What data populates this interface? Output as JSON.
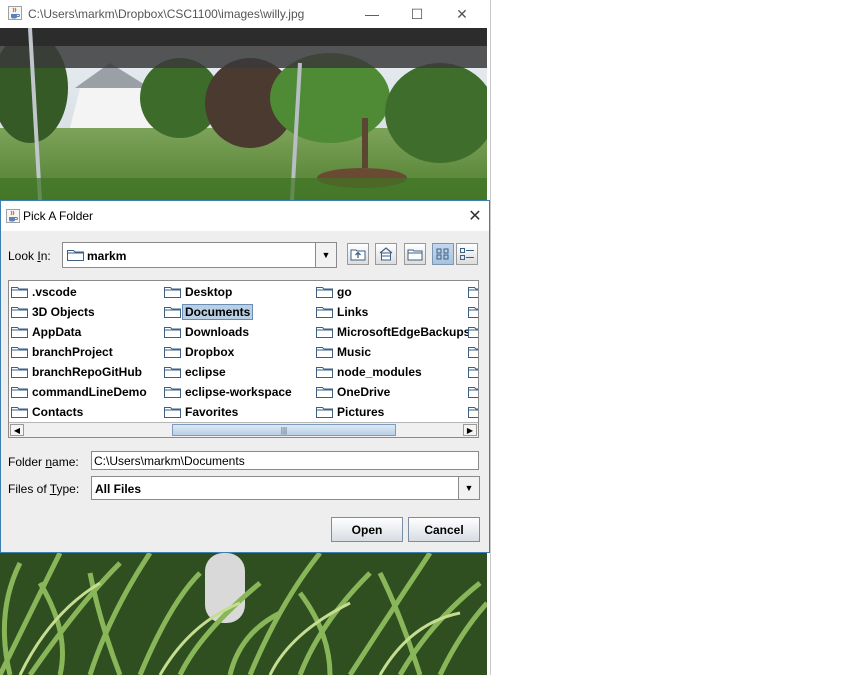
{
  "image_window": {
    "title": "C:\\Users\\markm\\Dropbox\\CSC1100\\images\\willy.jpg",
    "controls": {
      "minimize": "—",
      "maximize": "☐",
      "close": "✕"
    }
  },
  "dialog": {
    "title": "Pick A Folder",
    "close_glyph": "✕",
    "look_in": {
      "label_pre": "Look ",
      "label_mnemonic": "I",
      "label_post": "n:",
      "value": "markm"
    },
    "toolbar_icons": [
      "up-one-level-icon",
      "home-icon",
      "new-folder-icon",
      "list-view-icon",
      "details-view-icon"
    ],
    "files": {
      "columns": [
        [
          ".vscode",
          "3D Objects",
          "AppData",
          "branchProject",
          "branchRepoGitHub",
          "commandLineDemo",
          "Contacts"
        ],
        [
          "Desktop",
          "Documents",
          "Downloads",
          "Dropbox",
          "eclipse",
          "eclipse-workspace",
          "Favorites"
        ],
        [
          "go",
          "Links",
          "MicrosoftEdgeBackups",
          "Music",
          "node_modules",
          "OneDrive",
          "Pictures"
        ]
      ],
      "selected": "Documents"
    },
    "scrollbar": {
      "left_glyph": "◀",
      "right_glyph": "▶",
      "thumb_grip": "|||"
    },
    "folder_name": {
      "label_pre": "Folder ",
      "label_mnemonic": "n",
      "label_post": "ame:",
      "value": "C:\\Users\\markm\\Documents"
    },
    "files_of_type": {
      "label_pre": "Files of ",
      "label_mnemonic": "T",
      "label_post": "ype:",
      "value": "All Files"
    },
    "buttons": {
      "open": "Open",
      "cancel": "Cancel"
    }
  },
  "colors": {
    "selection": "#b8cfe5",
    "dialog_bg": "#eeeeee",
    "border_accent": "#3c7fb1"
  }
}
